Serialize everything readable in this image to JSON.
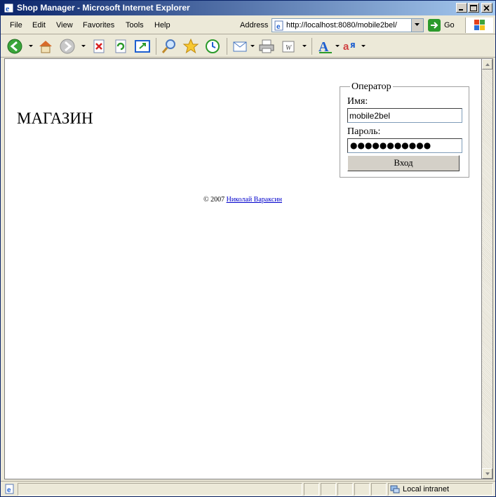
{
  "window": {
    "title": "Shop Manager - Microsoft Internet Explorer"
  },
  "menu": {
    "file": "File",
    "edit": "Edit",
    "view": "View",
    "favorites": "Favorites",
    "tools": "Tools",
    "help": "Help"
  },
  "address": {
    "label": "Address",
    "url": "http://localhost:8080/mobile2bel/",
    "go_label": "Go"
  },
  "page": {
    "shop_title": "МАГАЗИН",
    "login": {
      "legend": "Оператор",
      "name_label": "Имя:",
      "name_value": "mobile2bel",
      "password_label": "Пароль:",
      "password_value": "●●●●●●●●●●●",
      "submit_label": "Вход"
    },
    "footer": {
      "copyright": "© 2007",
      "author_link": "Николай Вараксин"
    }
  },
  "status": {
    "zone": "Local intranet"
  },
  "colors": {
    "titlebar_start": "#0a246a",
    "titlebar_end": "#a6caf0",
    "link": "#0000cc"
  }
}
